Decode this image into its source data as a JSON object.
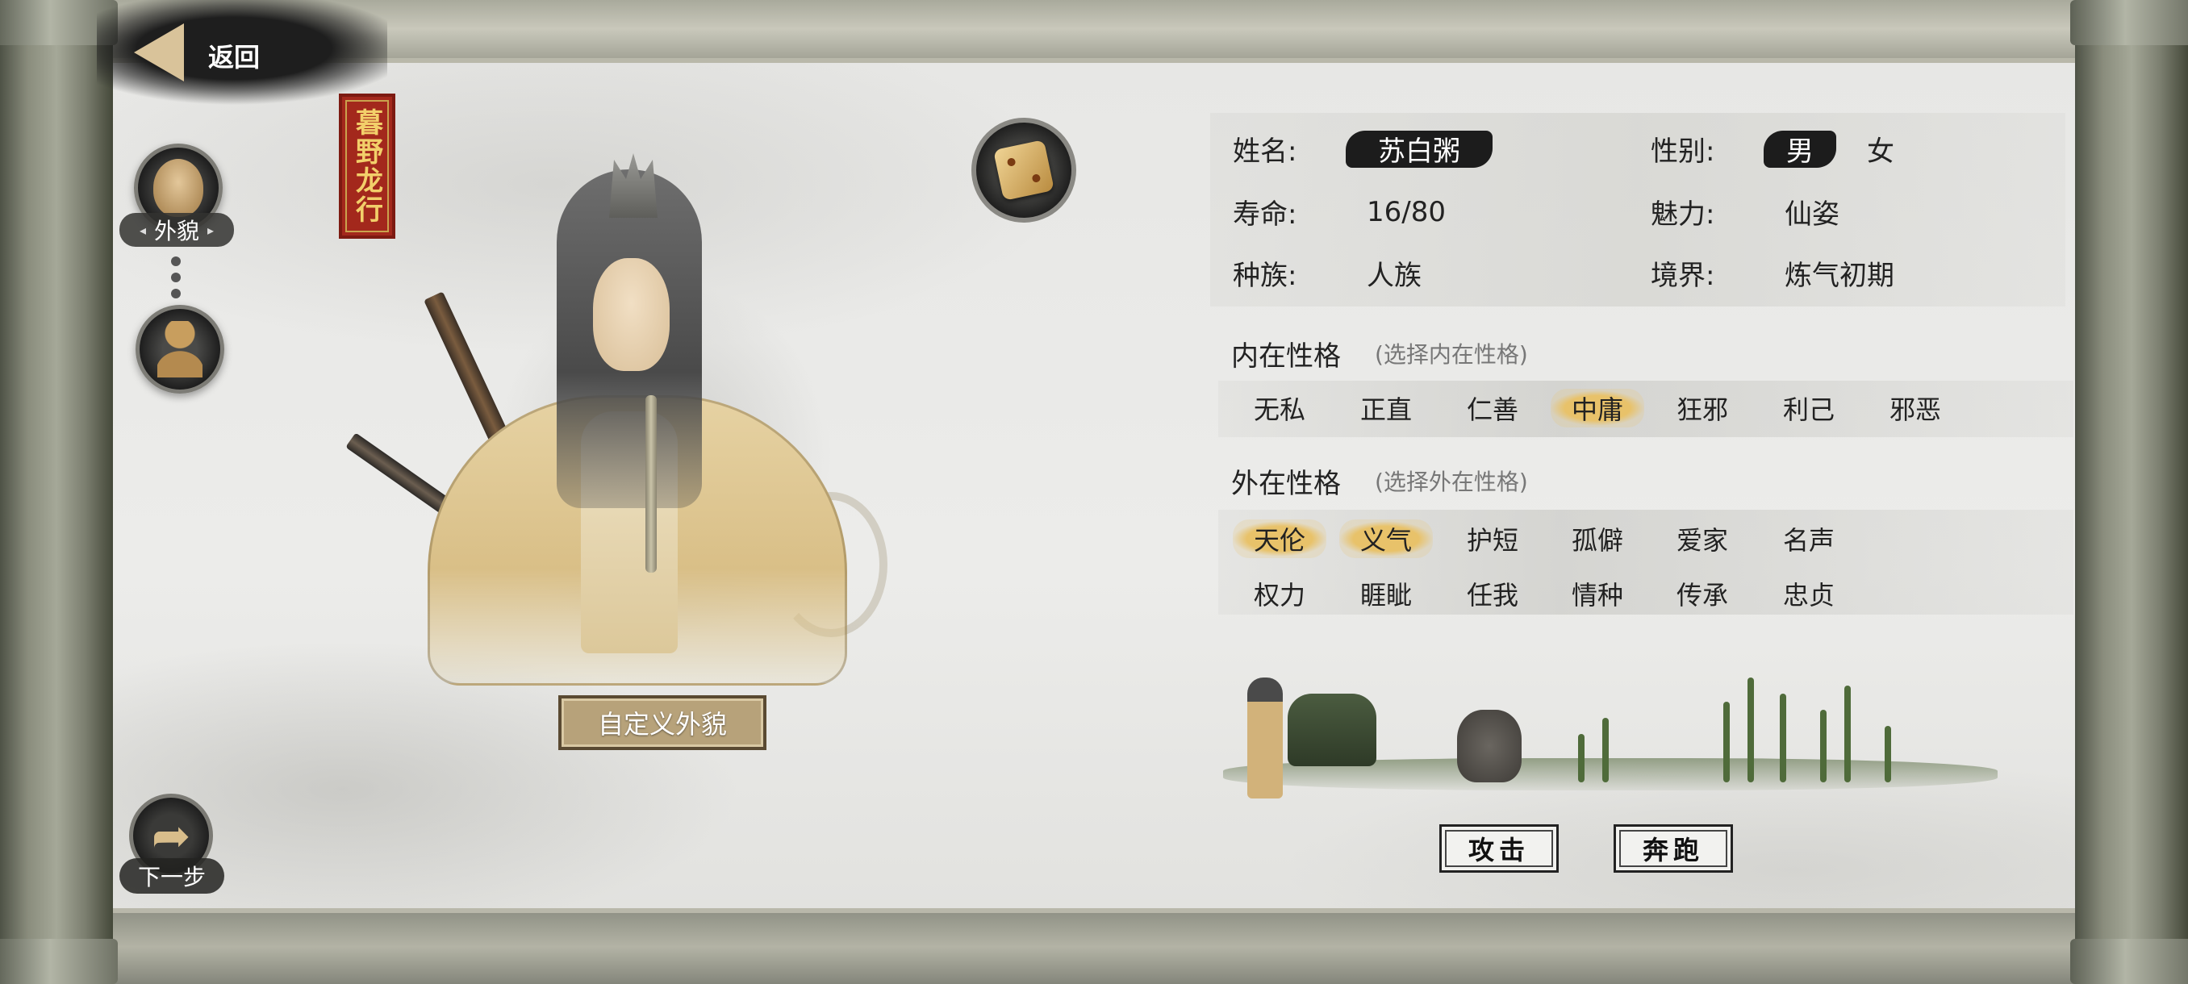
{
  "header": {
    "back_label": "返回"
  },
  "sidebar": {
    "appearance_label": "外貌",
    "next_label": "下一步"
  },
  "seal": {
    "text": "暮野龙行"
  },
  "portrait": {
    "custom_button": "自定义外貌"
  },
  "profile": {
    "name_label": "姓名:",
    "name_value": "苏白粥",
    "gender_label": "性别:",
    "gender_options": [
      "男",
      "女"
    ],
    "gender_selected": "男",
    "lifespan_label": "寿命:",
    "lifespan_value": "16/80",
    "charm_label": "魅力:",
    "charm_value": "仙姿",
    "race_label": "种族:",
    "race_value": "人族",
    "realm_label": "境界:",
    "realm_value": "炼气初期"
  },
  "inner_personality": {
    "title": "内在性格",
    "hint": "(选择内在性格)",
    "options": [
      "无私",
      "正直",
      "仁善",
      "中庸",
      "狂邪",
      "利己",
      "邪恶"
    ],
    "selected": [
      "中庸"
    ]
  },
  "outer_personality": {
    "title": "外在性格",
    "hint": "(选择外在性格)",
    "row1": [
      "天伦",
      "义气",
      "护短",
      "孤僻",
      "爱家",
      "名声"
    ],
    "row2": [
      "权力",
      "睚眦",
      "任我",
      "情种",
      "传承",
      "忠贞"
    ],
    "selected": [
      "天伦",
      "义气"
    ]
  },
  "actions": {
    "attack": "攻击",
    "run": "奔跑"
  },
  "colors": {
    "accent_gold": "#e8c26a",
    "ink": "#1c1c1c",
    "seal_red": "#a3281c"
  },
  "icons": [
    "back-arrow-icon",
    "face-icon",
    "bust-icon",
    "dice-icon",
    "next-arrow-icon"
  ]
}
